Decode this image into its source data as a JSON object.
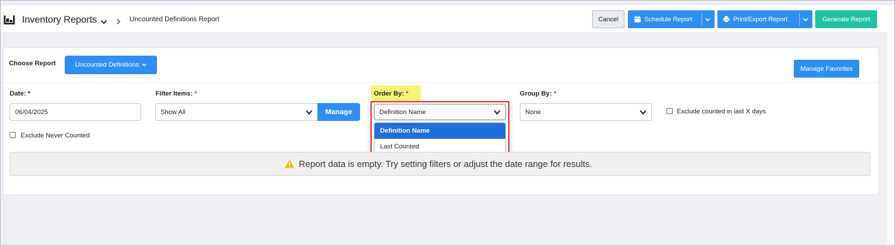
{
  "header": {
    "app_title": "Inventory Reports",
    "breadcrumb": "Uncounted Definitions Report",
    "buttons": {
      "cancel": "Cancel",
      "schedule": "Schedule Report",
      "print_export": "Print/Export Report",
      "generate": "Generate Report"
    }
  },
  "report": {
    "choose_label": "Choose Report",
    "choose_value": "Uncounted Definitions",
    "manage_favorites": "Manage Favorites"
  },
  "filters": {
    "date": {
      "label": "Date:",
      "required": "*",
      "value": "06/04/2025"
    },
    "filter_items": {
      "label": "Filter Items:",
      "required": "*",
      "value": "Show All",
      "manage": "Manage"
    },
    "order_by": {
      "label": "Order By:",
      "required": "*",
      "value": "Definition Name",
      "options": [
        "Definition Name",
        "Last Counted"
      ],
      "selected_index": 0
    },
    "group_by": {
      "label": "Group By:",
      "required": "*",
      "value": "None"
    },
    "exclude_counted": "Exclude counted in last X days",
    "exclude_never": "Exclude Never Counted"
  },
  "notice": {
    "text": "Report data is empty. Try setting filters or adjust the date range for results.",
    "icon": "warning-icon"
  },
  "colors": {
    "primary": "#2f8ff0",
    "generate": "#21c2a0",
    "highlight": "#f3f67a",
    "callout_border": "#e0403e",
    "selected_option": "#1f6fd6",
    "warning": "#f2b705"
  }
}
